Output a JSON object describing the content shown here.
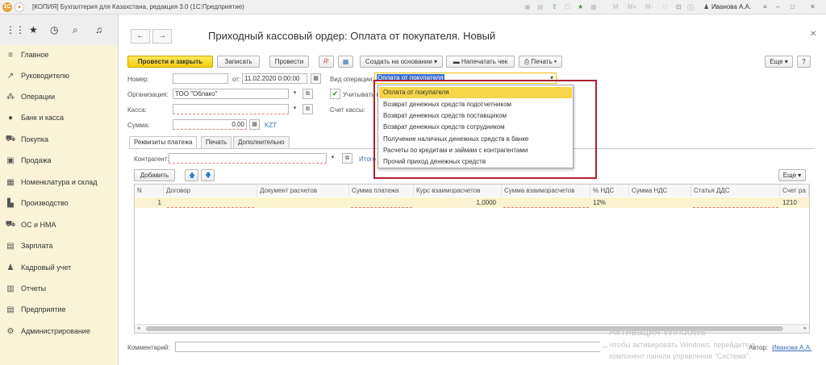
{
  "window": {
    "title": "[КОПИЯ] Бухгалтерия для Казахстана, редакция 3.0  (1С:Предприятие)",
    "logo": "1С",
    "user": "Иванова А.А.",
    "toolbar_letters": [
      "M",
      "M+",
      "M-"
    ]
  },
  "sidebar": {
    "items": [
      {
        "label": "Главное",
        "icon": "menu-icon"
      },
      {
        "label": "Руководителю",
        "icon": "trend-icon"
      },
      {
        "label": "Операции",
        "icon": "operations-icon"
      },
      {
        "label": "Банк и касса",
        "icon": "bank-icon"
      },
      {
        "label": "Покупка",
        "icon": "cart-icon"
      },
      {
        "label": "Продажа",
        "icon": "bag-icon"
      },
      {
        "label": "Номенклатура и склад",
        "icon": "warehouse-icon"
      },
      {
        "label": "Производство",
        "icon": "factory-icon"
      },
      {
        "label": "ОС и НМА",
        "icon": "truck-icon"
      },
      {
        "label": "Зарплата",
        "icon": "salary-icon"
      },
      {
        "label": "Кадровый учет",
        "icon": "people-icon"
      },
      {
        "label": "Отчеты",
        "icon": "chart-icon"
      },
      {
        "label": "Предприятие",
        "icon": "building-icon"
      },
      {
        "label": "Администрирование",
        "icon": "gear-icon"
      }
    ]
  },
  "document": {
    "title": "Приходный кассовый ордер: Оплата от покупателя. Новый",
    "toolbar": {
      "post_close": "Провести и закрыть",
      "save": "Записать",
      "post": "Провести",
      "create_based": "Создать на основании",
      "print_receipt": "Напечатать чек",
      "print": "Печать",
      "more": "Еще",
      "help": "?"
    },
    "form": {
      "number_label": "Номер:",
      "number_value": "",
      "date_label": "от:",
      "date_value": "11.02.2020  0:00:00",
      "operation_label": "Вид операции:",
      "operation_value": "Оплата от покупателя",
      "org_label": "Организация:",
      "org_value": "ТОО \"Облако\"",
      "consider_label": "Учитывать в",
      "kassa_label": "Касса:",
      "kassa_value": "",
      "account_label": "Счет кассы:",
      "sum_label": "Сумма:",
      "sum_value": "0,00",
      "currency": "KZT"
    },
    "tabs": [
      "Реквизиты платежа",
      "Печать",
      "Дополнительно"
    ],
    "counterparty_label": "Контрагент:",
    "counterparty_value": "",
    "itogo": "Итого",
    "add_button": "Добавить",
    "more_button": "Еще",
    "table": {
      "columns": [
        "N",
        "Договор",
        "Документ расчетов",
        "Сумма платежа",
        "Курс взаиморасчетов",
        "Сумма взаиморасчетов",
        "% НДС",
        "Сумма НДС",
        "Статья ДДС",
        "Счет ра"
      ],
      "rows": [
        [
          "1",
          "",
          "",
          "",
          "1,0000",
          "",
          "12%",
          "",
          "",
          "1210"
        ]
      ]
    },
    "comment_label": "Комментарий:",
    "comment_value": "",
    "author_label": "Автор:",
    "author_value": "Иванова А.А."
  },
  "dropdown": {
    "options": [
      "Оплата от покупателя",
      "Возврат денежных средств подотчетником",
      "Возврат денежных средств поставщиком",
      "Возврат денежных средств сотрудником",
      "Получение наличных денежных средств в банке",
      "Расчеты по кредитам и займам с контрагентами",
      "Прочий приход денежных средств"
    ],
    "selected": 0
  },
  "activation": {
    "title": "Активация Windows",
    "line1": "Чтобы активировать Windows, перейдите в",
    "line2": "компонент панели управления \"Система\"."
  },
  "colors": {
    "accent_yellow": "#f4cc10",
    "sidebar_bg": "#faf3d7",
    "selection": "#f7d54a",
    "highlight_border": "#b02030",
    "link": "#3a6fb0"
  }
}
